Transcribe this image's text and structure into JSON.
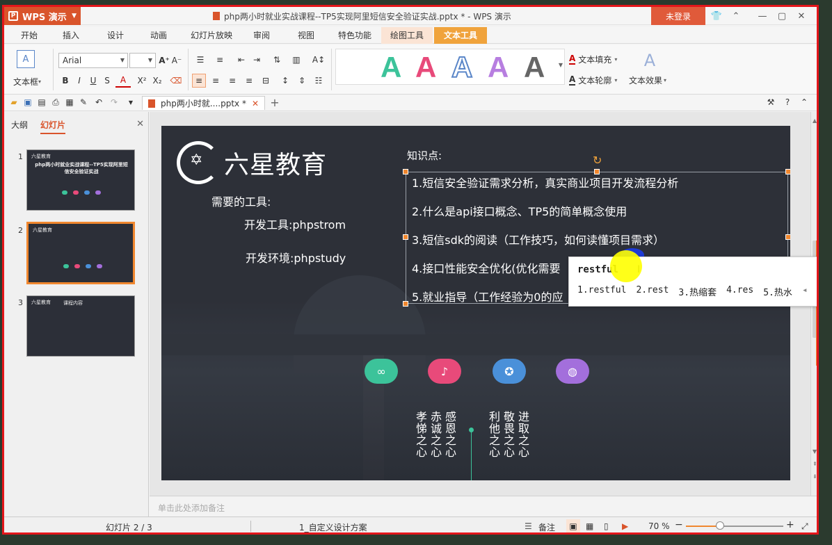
{
  "app": {
    "name": "WPS 演示",
    "window_title": "php两小时就业实战课程--TP5实现阿里短信安全验证实战.pptx * - WPS 演示",
    "login": "未登录"
  },
  "menu": [
    "开始",
    "插入",
    "设计",
    "动画",
    "幻灯片放映",
    "审阅",
    "视图",
    "特色功能",
    "绘图工具",
    "文本工具"
  ],
  "ribbon": {
    "textbox_label": "文本框",
    "font_name": "Arial",
    "font_size": "",
    "text_fill": "文本填充",
    "text_outline": "文本轮廓",
    "text_effect": "文本效果",
    "wordart_colors": [
      "#3cc39a",
      "#e84a7a",
      "#5a86c8",
      "#b77ee0",
      "#666666"
    ]
  },
  "doc_tab": "php两小时就....pptx *",
  "panel": {
    "tab_outline": "大纲",
    "tab_slides": "幻灯片",
    "thumbnails": [
      {
        "num": "1",
        "title": "php两小时就业实战课程--TP5实现阿里短信安全验证实战",
        "brand": "六星教育"
      },
      {
        "num": "2",
        "brand": "六星教育"
      },
      {
        "num": "3",
        "brand": "六星教育",
        "title": "课程内容"
      }
    ]
  },
  "slide": {
    "brand": "六星教育",
    "tools_heading": "需要的工具:",
    "tool_dev": "开发工具:phpstrom",
    "tool_env": "开发环境:phpstudy",
    "kp_heading": "知识点:",
    "kp": [
      "1.短信安全验证需求分析，真实商业项目开发流程分析",
      "2.什么是api接口概念、TP5的简单概念使用",
      "3.短信sdk的阅读（工作技巧，如何读懂项目需求）",
      "4.接口性能安全优化(优化需要",
      "5.就业指导（工作经验为0的应"
    ],
    "icons": [
      {
        "name": "glasses-icon",
        "color": "#3cc39a",
        "glyph": "∞"
      },
      {
        "name": "microphone-icon",
        "color": "#e84a7a",
        "glyph": "♪"
      },
      {
        "name": "lightbulb-icon",
        "color": "#4a90d9",
        "glyph": "✪"
      },
      {
        "name": "mouse-icon",
        "color": "#a36fdc",
        "glyph": "◍"
      }
    ],
    "mottos_left": [
      "孝悌之心",
      "赤诚之心",
      "感恩之心"
    ],
    "mottos_right": [
      "利他之心",
      "敬畏之心",
      "进取之心"
    ]
  },
  "ime": {
    "input": "restful",
    "candidates": [
      "1.restful",
      "2.rest",
      "3.热缩套",
      "4.res",
      "5.热水"
    ]
  },
  "notes_placeholder": "单击此处添加备注",
  "status": {
    "slide_info": "幻灯片 2 / 3",
    "theme": "1_自定义设计方案",
    "notes_btn": "备注",
    "zoom": "70 %",
    "zoom_fraction": 0.35
  }
}
